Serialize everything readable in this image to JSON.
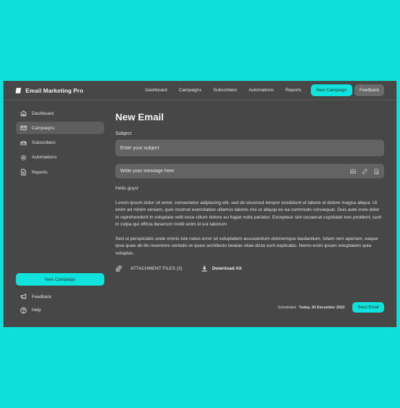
{
  "app": {
    "logo_text": "Email Marketing Pro"
  },
  "topnav": {
    "links": [
      "Dashboard",
      "Campaigns",
      "Subscribers",
      "Automations",
      "Reports"
    ],
    "new_campaign": "New Campaign",
    "feedback": "Feedback"
  },
  "sidebar": {
    "items": [
      {
        "label": "Dashboard",
        "icon": "home-icon",
        "active": false
      },
      {
        "label": "Campaigns",
        "icon": "mail-icon",
        "active": true
      },
      {
        "label": "Subscribers",
        "icon": "users-icon",
        "active": false
      },
      {
        "label": "Automations",
        "icon": "gear-icon",
        "active": false
      },
      {
        "label": "Reports",
        "icon": "document-icon",
        "active": false
      }
    ],
    "new_campaign": "New Campaign",
    "bottom": [
      {
        "label": "Feedback",
        "icon": "megaphone-icon"
      },
      {
        "label": "Help",
        "icon": "help-icon"
      }
    ]
  },
  "compose": {
    "title": "New Email",
    "subject_label": "Subject",
    "subject_placeholder": "Enter your subject",
    "message_placeholder": "Write your message here",
    "greeting": "Hello guys!",
    "paragraph1": "Lorem ipsum dolor sit amet, consectetur adipiscing elit, sed do eiusmod tempor incididunt ut labore et dolore magna aliqua. Ut enim ad minim veniam, quis nostrud exercitation ullamco laboris nisi ut aliquip ex ea commodo consequat. Duis aute irure dolor in reprehenderit in voluptate velit esse cillum dolore eu fugiat nulla pariatur. Excepteur sint occaecat cupidatat non proident, sunt in culpa qui officia deserunt mollit anim id est laborum",
    "paragraph2": "Sed ut perspiciatis unde omnis iste natus error sit voluptatem accusantium doloremque laudantium, totam rem aperiam, eaque ipsa quae ab illo inventore veritatis et quasi architecto beatae vitae dicta sunt explicabo. Nemo enim ipsam voluptatem quia voluptas.",
    "attachment_label": "ATTACHMENT FILES (3)",
    "download_all": "Download All",
    "scheduled_prefix": "Scheduled : ",
    "scheduled_date": "Today, 20 December 2022",
    "send_button": "Send Email"
  },
  "colors": {
    "background": "#0ee0d9",
    "panel": "#474747",
    "accent": "#0fe3dc"
  }
}
